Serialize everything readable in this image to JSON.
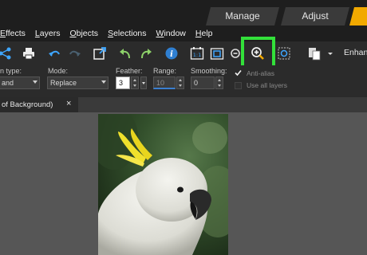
{
  "workspace_tabs": [
    "Manage",
    "Adjust"
  ],
  "colors": {
    "accent": "#f2a900",
    "highlight": "#33e03a"
  },
  "menu": [
    {
      "label": "Effects",
      "underline": "E",
      "rest": "ffects"
    },
    {
      "label": "Layers",
      "underline": "L",
      "rest": "ayers"
    },
    {
      "label": "Objects",
      "underline": "O",
      "rest": "bjects"
    },
    {
      "label": "Selections",
      "underline": "S",
      "rest": "elections"
    },
    {
      "label": "Window",
      "underline": "W",
      "rest": "indow"
    },
    {
      "label": "Help",
      "underline": "H",
      "rest": "elp"
    }
  ],
  "toolbar": {
    "icons": [
      "share-icon",
      "print-icon",
      "undo-icon",
      "redo-icon",
      "resize-icon",
      "rotate-left-icon",
      "rotate-right-icon",
      "info-icon",
      "actual-size-icon",
      "fit-window-icon",
      "zoom-out-icon",
      "zoom-in-icon",
      "zoom-to-selection-icon",
      "paste-icon"
    ],
    "enhance_label": "Enhan"
  },
  "tool_options": {
    "selection_type_label": "n type:",
    "selection_type_value": "and",
    "mode_label": "Mode:",
    "mode_value": "Replace",
    "feather_label": "Feather:",
    "feather_value": "3",
    "range_label": "Range:",
    "range_value": "10",
    "smoothing_label": "Smoothing:",
    "smoothing_value": "0",
    "anti_alias_label": "Anti-alias",
    "anti_alias_checked": true,
    "use_all_layers_label": "Use all layers",
    "use_all_layers_checked": false
  },
  "document_tab": {
    "title": "of Background)",
    "close": "×"
  }
}
